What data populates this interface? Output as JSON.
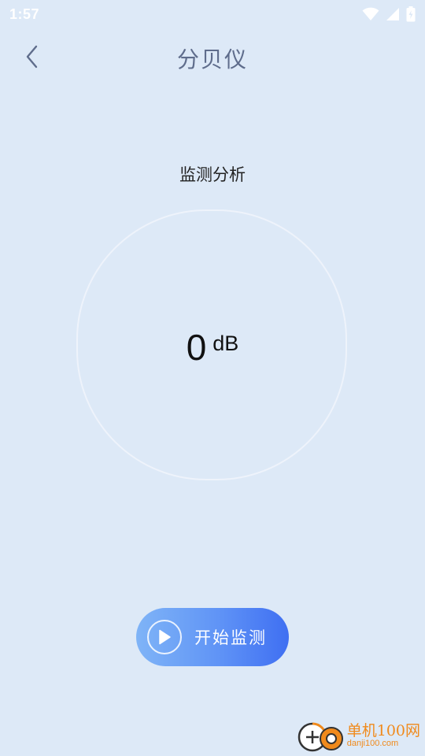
{
  "status_bar": {
    "time": "1:57",
    "icons": [
      "wifi-icon",
      "signal-icon",
      "battery-icon"
    ]
  },
  "header": {
    "title": "分贝仪",
    "back_icon": "chevron-left-icon"
  },
  "section": {
    "title": "监测分析"
  },
  "meter": {
    "value": "0",
    "unit": "dB"
  },
  "action": {
    "label": "开始监测",
    "icon": "play-icon"
  },
  "watermark": {
    "brand": "单机100网",
    "url": "danji100.com"
  },
  "colors": {
    "background": "#dde9f7",
    "title": "#5f6d8c",
    "button_start": "#7fb4f7",
    "button_end": "#3f6ff2",
    "watermark": "#f08a1c"
  }
}
